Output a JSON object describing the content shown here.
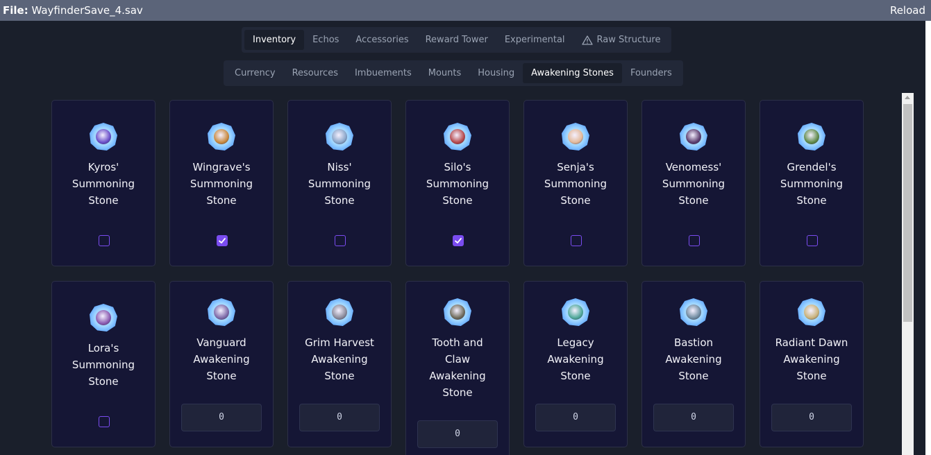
{
  "titlebar": {
    "file_label": "File:",
    "file_name": "WayfinderSave_4.sav",
    "reload_label": "Reload"
  },
  "main_tabs": [
    {
      "label": "Inventory",
      "active": true
    },
    {
      "label": "Echos",
      "active": false
    },
    {
      "label": "Accessories",
      "active": false
    },
    {
      "label": "Reward Tower",
      "active": false
    },
    {
      "label": "Experimental",
      "active": false
    },
    {
      "label": "Raw Structure",
      "active": false,
      "icon": "warning-icon"
    }
  ],
  "sub_tabs": [
    {
      "label": "Currency",
      "active": false
    },
    {
      "label": "Resources",
      "active": false
    },
    {
      "label": "Imbuements",
      "active": false
    },
    {
      "label": "Mounts",
      "active": false
    },
    {
      "label": "Housing",
      "active": false
    },
    {
      "label": "Awakening Stones",
      "active": true
    },
    {
      "label": "Founders",
      "active": false
    }
  ],
  "items": [
    {
      "name": "Kyros'\nSummoning\nStone",
      "kind": "checkbox",
      "checked": false,
      "core_color": "#6a4fc9"
    },
    {
      "name": "Wingrave's\nSummoning\nStone",
      "kind": "checkbox",
      "checked": true,
      "core_color": "#c98a3f"
    },
    {
      "name": "Niss'\nSummoning\nStone",
      "kind": "checkbox",
      "checked": false,
      "core_color": "#8aa6c9"
    },
    {
      "name": "Silo's\nSummoning\nStone",
      "kind": "checkbox",
      "checked": true,
      "core_color": "#b5484a"
    },
    {
      "name": "Senja's\nSummoning\nStone",
      "kind": "checkbox",
      "checked": false,
      "core_color": "#e3b99a"
    },
    {
      "name": "Venomess'\nSummoning\nStone",
      "kind": "checkbox",
      "checked": false,
      "core_color": "#5a3c6e"
    },
    {
      "name": "Grendel's\nSummoning\nStone",
      "kind": "checkbox",
      "checked": false,
      "core_color": "#5f8a4a"
    },
    {
      "name": "Lora's\nSummoning\nStone",
      "kind": "checkbox",
      "checked": false,
      "core_color": "#8a5ab0"
    },
    {
      "name": "Vanguard\nAwakening\nStone",
      "kind": "quantity",
      "value": "0",
      "core_color": "#7d6aa8"
    },
    {
      "name": "Grim Harvest\nAwakening\nStone",
      "kind": "quantity",
      "value": "0",
      "core_color": "#8a8a9a"
    },
    {
      "name": "Tooth and\nClaw\nAwakening\nStone",
      "kind": "quantity",
      "value": "0",
      "core_color": "#6e6a5a"
    },
    {
      "name": "Legacy\nAwakening\nStone",
      "kind": "quantity",
      "value": "0",
      "core_color": "#4fa89a"
    },
    {
      "name": "Bastion\nAwakening\nStone",
      "kind": "quantity",
      "value": "0",
      "core_color": "#6f8aa0"
    },
    {
      "name": "Radiant Dawn\nAwakening\nStone",
      "kind": "quantity",
      "value": "0",
      "core_color": "#c9b27a"
    }
  ],
  "colors": {
    "background": "#1a1f2b",
    "card": "#151635",
    "accent": "#7a4cf0",
    "titlebar": "#5b6479"
  }
}
